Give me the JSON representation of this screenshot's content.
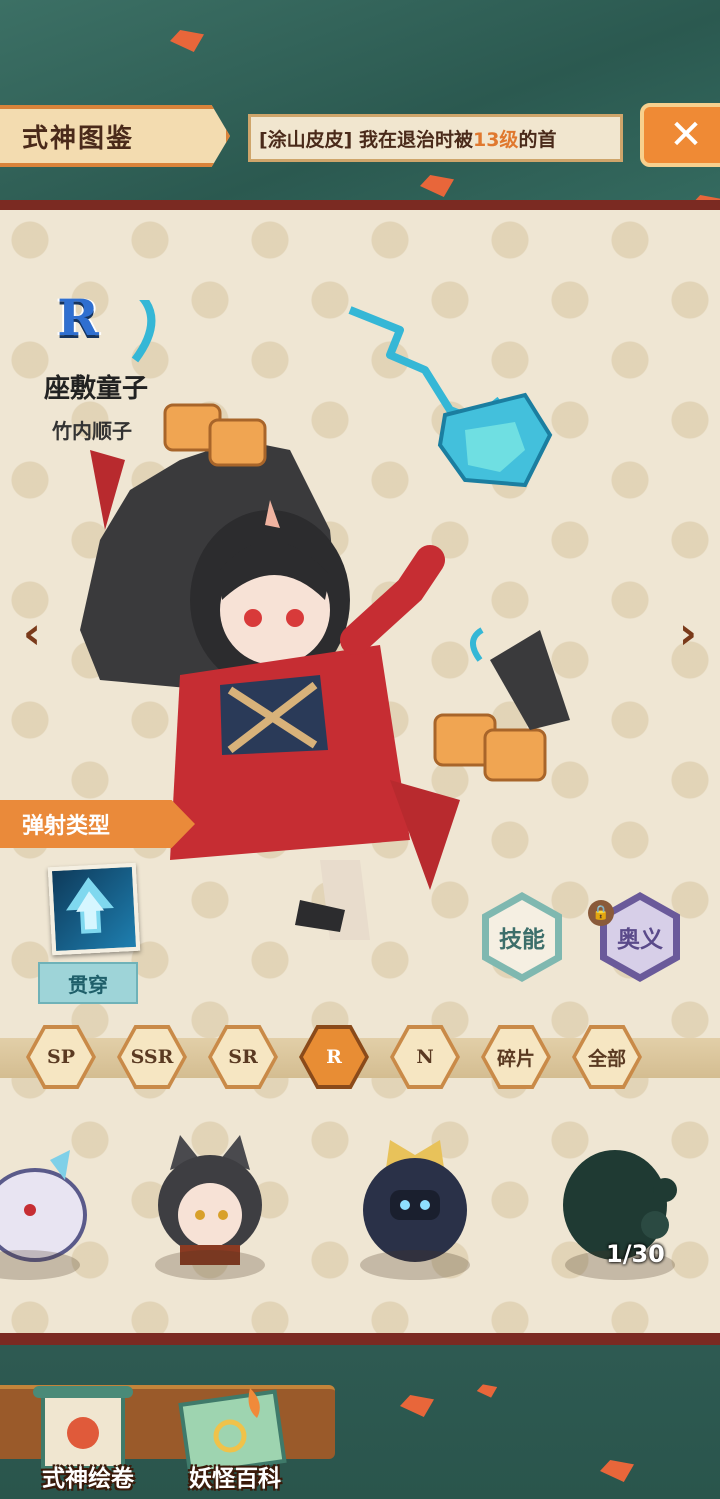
{
  "header": {
    "title": "式神图鉴",
    "ticker_prefix": "[涂山皮皮] 我在退治时被",
    "ticker_highlight": "13级",
    "ticker_suffix": "的首",
    "close_icon": "close-icon"
  },
  "character": {
    "rarity": "R",
    "name": "座敷童子",
    "voice_actor": "竹内顺子"
  },
  "type_panel": {
    "section_title": "弹射类型",
    "type_label": "贯穿"
  },
  "actions": {
    "skill_label": "技能",
    "ultimate_label": "奥义"
  },
  "filters": [
    "SP",
    "SSR",
    "SR",
    "R",
    "N",
    "碎片",
    "全部"
  ],
  "active_filter": "R",
  "roster": {
    "counter": "1/30"
  },
  "bottom_nav": {
    "item1": "式神绘卷",
    "item2": "妖怪百科"
  },
  "colors": {
    "accent": "#e88d34",
    "teal": "#2f5d55",
    "parchment": "#efe6d3"
  }
}
